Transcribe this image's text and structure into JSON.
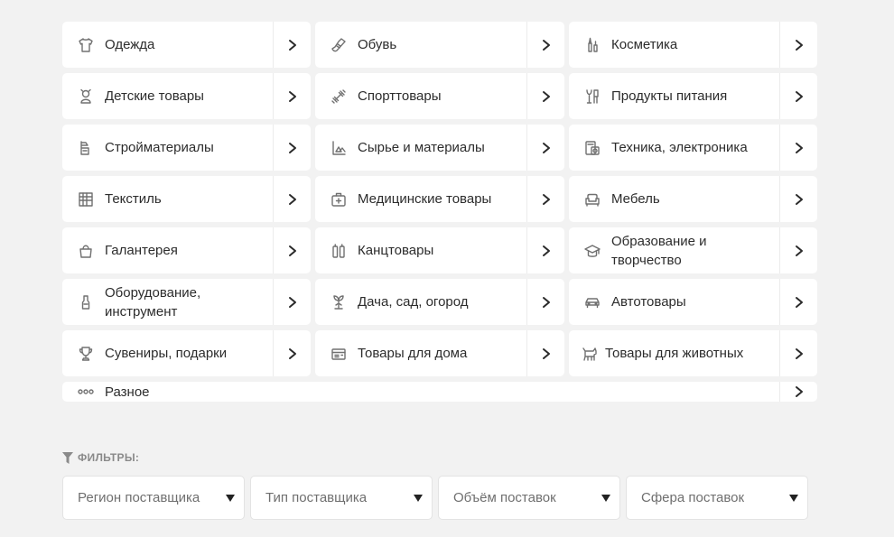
{
  "categories": [
    {
      "label": "Одежда",
      "icon": "shirt-icon"
    },
    {
      "label": "Обувь",
      "icon": "shoe-icon"
    },
    {
      "label": "Косметика",
      "icon": "cosmetics-icon"
    },
    {
      "label": "Детские товары",
      "icon": "baby-icon"
    },
    {
      "label": "Спорттовары",
      "icon": "dumbbell-icon"
    },
    {
      "label": "Продукты питания",
      "icon": "food-icon"
    },
    {
      "label": "Стройматериалы",
      "icon": "construction-icon"
    },
    {
      "label": "Сырье и материалы",
      "icon": "materials-icon"
    },
    {
      "label": "Техника, электроника",
      "icon": "electronics-icon"
    },
    {
      "label": "Текстиль",
      "icon": "textile-icon"
    },
    {
      "label": "Медицинские товары",
      "icon": "medkit-icon"
    },
    {
      "label": "Мебель",
      "icon": "sofa-icon"
    },
    {
      "label": "Галантерея",
      "icon": "bag-icon"
    },
    {
      "label": "Канцтовары",
      "icon": "stationery-icon"
    },
    {
      "label": "Образование и творчество",
      "icon": "graduation-icon"
    },
    {
      "label": "Оборудование, инструмент",
      "icon": "tool-icon"
    },
    {
      "label": "Дача, сад, огород",
      "icon": "garden-icon"
    },
    {
      "label": "Автотовары",
      "icon": "car-icon"
    },
    {
      "label": "Сувениры, подарки",
      "icon": "trophy-icon"
    },
    {
      "label": "Товары для дома",
      "icon": "home-goods-icon"
    },
    {
      "label": "Товары для животных",
      "icon": "pet-icon"
    },
    {
      "label": "Разное",
      "icon": "dots-icon"
    }
  ],
  "filters": {
    "title": "ФИЛЬТРЫ:",
    "selects": [
      {
        "value": "Регион поставщика"
      },
      {
        "value": "Тип поставщика"
      },
      {
        "value": "Объём поставок"
      },
      {
        "value": "Сфера поставок"
      }
    ]
  }
}
